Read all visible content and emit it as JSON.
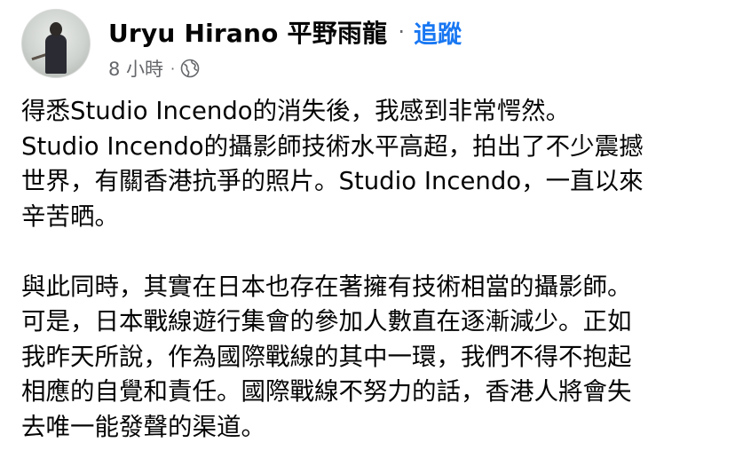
{
  "post": {
    "author": "Uryu Hirano 平野雨龍",
    "separator": "·",
    "follow_label": "追蹤",
    "timestamp": "8 小時",
    "meta_separator": "·",
    "privacy_icon": "globe-icon",
    "paragraphs": [
      {
        "lines": [
          "得悉Studio Incendo的消失後，我感到非常愕然。",
          "Studio Incendo的攝影師技術水平高超，拍出了不少震撼",
          "世界，有關香港抗爭的照片。Studio Incendo，一直以來",
          "辛苦晒。"
        ]
      },
      {
        "lines": [
          "與此同時，其實在日本也存在著擁有技術相當的攝影師。",
          "可是，日本戰線遊行集會的參加人數直在逐漸減少。正如",
          "我昨天所說，作為國際戰線的其中一環，我們不得不抱起",
          "相應的自覺和責任。國際戰線不努力的話，香港人將會失",
          "去唯一能發聲的渠道。"
        ]
      }
    ]
  },
  "colors": {
    "text_primary": "#050505",
    "text_secondary": "#65676b",
    "link_blue": "#1877f2"
  }
}
